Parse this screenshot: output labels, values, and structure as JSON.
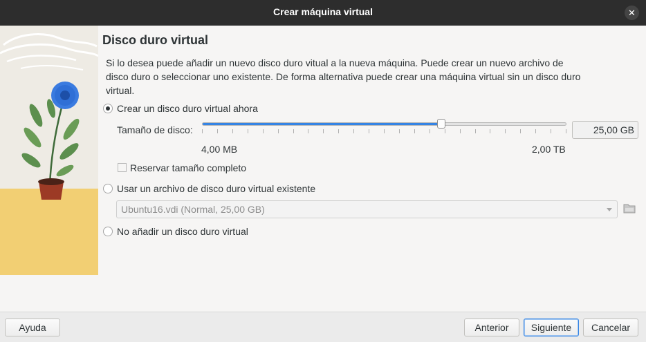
{
  "window": {
    "title": "Crear máquina virtual",
    "close_glyph": "✕"
  },
  "page": {
    "heading": "Disco duro virtual",
    "description": "Si lo desea puede añadir un nuevo disco duro vitual a la nueva máquina. Puede crear un nuevo archivo de disco duro o seleccionar uno existente. De forma alternativa puede crear una máquina virtual sin un disco duro virtual."
  },
  "options": {
    "create_new": {
      "label": "Crear un disco duro virtual ahora",
      "checked": true
    },
    "use_existing": {
      "label": "Usar un archivo de disco duro virtual existente",
      "checked": false
    },
    "no_disk": {
      "label": "No añadir un disco duro virtual",
      "checked": false
    }
  },
  "disk_size": {
    "label": "Tamaño de disco:",
    "min_label": "4,00 MB",
    "max_label": "2,00 TB",
    "value_text": "25,00 GB",
    "slider_fraction": 0.657,
    "tick_count": 24
  },
  "reserve_full": {
    "label": "Reservar tamaño completo",
    "checked": false
  },
  "existing_file": {
    "selected": "Ubuntu16.vdi (Normal, 25,00 GB)",
    "icon": "folder-icon"
  },
  "buttons": {
    "help": "Ayuda",
    "back": "Anterior",
    "next": "Siguiente",
    "cancel": "Cancelar"
  },
  "colors": {
    "accent": "#3584e4",
    "titlebar": "#2d2d2d"
  }
}
